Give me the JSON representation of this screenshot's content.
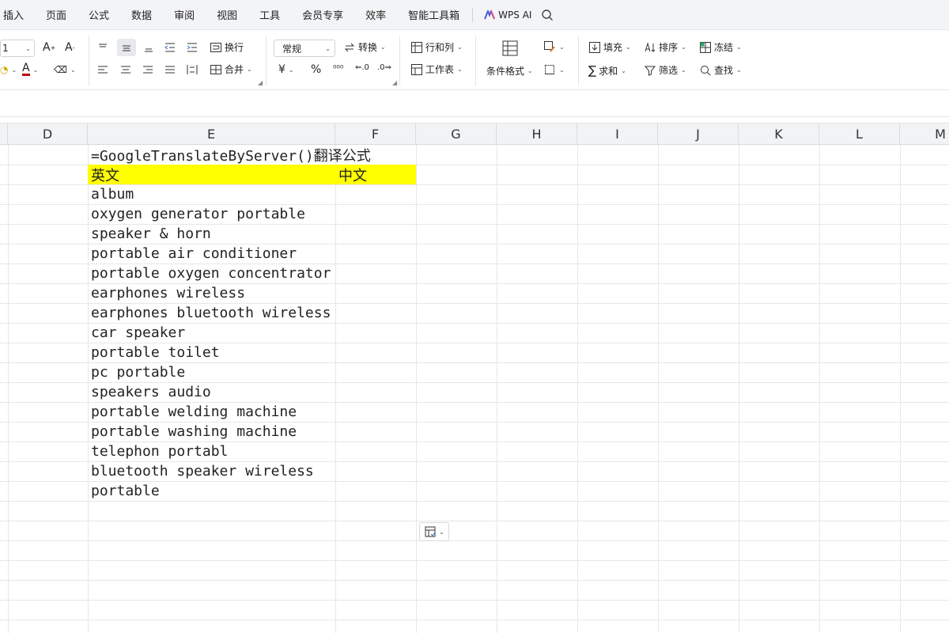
{
  "menu": {
    "items": [
      "插入",
      "页面",
      "公式",
      "数据",
      "审阅",
      "视图",
      "工具",
      "会员专享",
      "效率",
      "智能工具箱"
    ],
    "wps_ai": "WPS AI"
  },
  "ribbon": {
    "font_size": "1",
    "wrap_text": "换行",
    "merge": "合并",
    "number_format": "常规",
    "convert": "转换",
    "rows_cols": "行和列",
    "worksheet": "工作表",
    "cond_format": "条件格式",
    "fill": "填充",
    "sort": "排序",
    "freeze": "冻结",
    "sum": "求和",
    "filter": "筛选",
    "find": "查找",
    "currency_symbol": "¥",
    "percent_symbol": "%",
    "font_color_glyph": "A",
    "accent_color": "#c00000"
  },
  "columns": [
    "D",
    "E",
    "F",
    "G",
    "H",
    "I",
    "J",
    "K",
    "L",
    "M"
  ],
  "sheet": {
    "formula_note": "=GoogleTranslateByServer()翻译公式",
    "header_en": "英文",
    "header_zh": "中文",
    "header_fill": "#ffff00",
    "rows": [
      "album",
      "oxygen generator portable",
      "speaker & horn",
      "portable air conditioner",
      "portable oxygen concentrator",
      "earphones wireless",
      "earphones bluetooth wireless",
      "car speaker",
      "portable toilet",
      "pc portable",
      "speakers audio",
      "portable welding machine",
      "portable washing machine",
      "telephon portabl",
      "bluetooth speaker wireless",
      "portable"
    ]
  }
}
